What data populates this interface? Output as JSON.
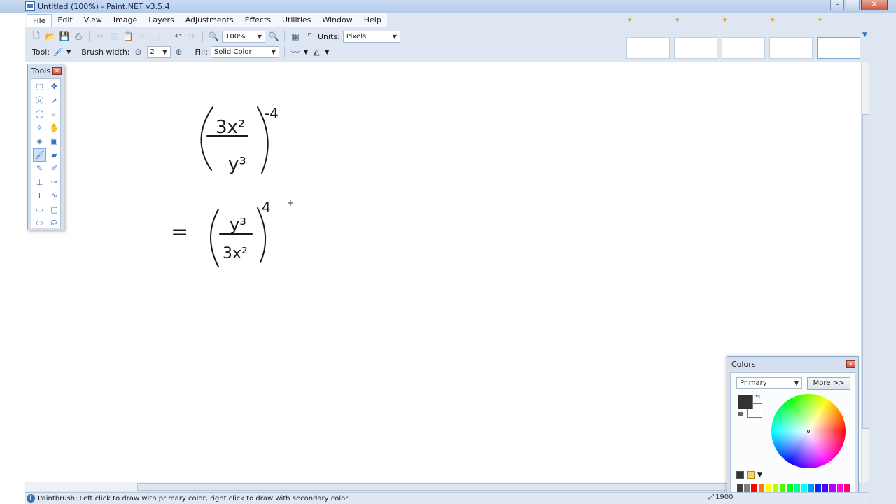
{
  "window": {
    "title": "Untitled (100%) - Paint.NET v3.5.4"
  },
  "menu": [
    "File",
    "Edit",
    "View",
    "Image",
    "Layers",
    "Adjustments",
    "Effects",
    "Utilities",
    "Window",
    "Help"
  ],
  "toolbar": {
    "zoom_value": "100%",
    "units_label": "Units:",
    "units_value": "Pixels",
    "tool_label": "Tool:",
    "brush_width_label": "Brush width:",
    "brush_width_value": "2",
    "fill_label": "Fill:",
    "fill_value": "Solid Color"
  },
  "tools_window": {
    "title": "Tools"
  },
  "colors_window": {
    "title": "Colors",
    "mode_value": "Primary",
    "more_label": "More >>",
    "primary_color": "#333333",
    "secondary_color": "#ffffff",
    "palette": [
      "#404040",
      "#808080",
      "#ff0000",
      "#ff7f00",
      "#ffff00",
      "#b6ff00",
      "#4cff00",
      "#00ff21",
      "#00ff90",
      "#00ffff",
      "#0094ff",
      "#0026ff",
      "#4800ff",
      "#b200ff",
      "#ff00dc",
      "#ff006e"
    ]
  },
  "canvas": {
    "expression_1": {
      "numerator": "3x²",
      "denominator": "y³",
      "exponent": "-4"
    },
    "expression_2": {
      "equals": "=",
      "numerator": "y³",
      "denominator": "3x²",
      "exponent": "4"
    }
  },
  "statusbar": {
    "message": "Paintbrush: Left click to draw with primary color, right click to draw with secondary color",
    "size_partial": "1900"
  }
}
